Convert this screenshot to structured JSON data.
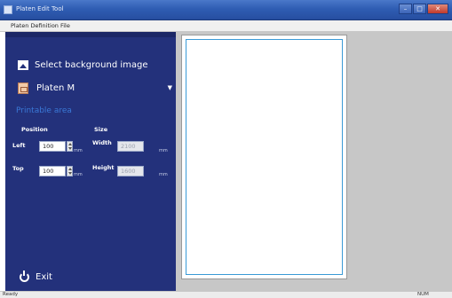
{
  "window": {
    "title": "Platen Edit Tool",
    "controls": [
      "minimize",
      "maximize",
      "close"
    ]
  },
  "menu": {
    "items": [
      "Platen Definition File"
    ]
  },
  "sidebar": {
    "select_background_label": "Select background image",
    "platen_selected": "Platen M",
    "printable_area_heading": "Printable area",
    "position_header": "Position",
    "size_header": "Size",
    "left_label": "Left",
    "left_value": "100",
    "top_label": "Top",
    "top_value": "100",
    "width_label": "Width",
    "width_value": "2100",
    "height_label": "Height",
    "height_value": "1600",
    "unit": "mm",
    "exit_label": "Exit",
    "colors": {
      "panel": "#23317b",
      "heading": "#3a78d6"
    }
  },
  "statusbar": {
    "status": "Ready",
    "indicator": "NUM"
  }
}
